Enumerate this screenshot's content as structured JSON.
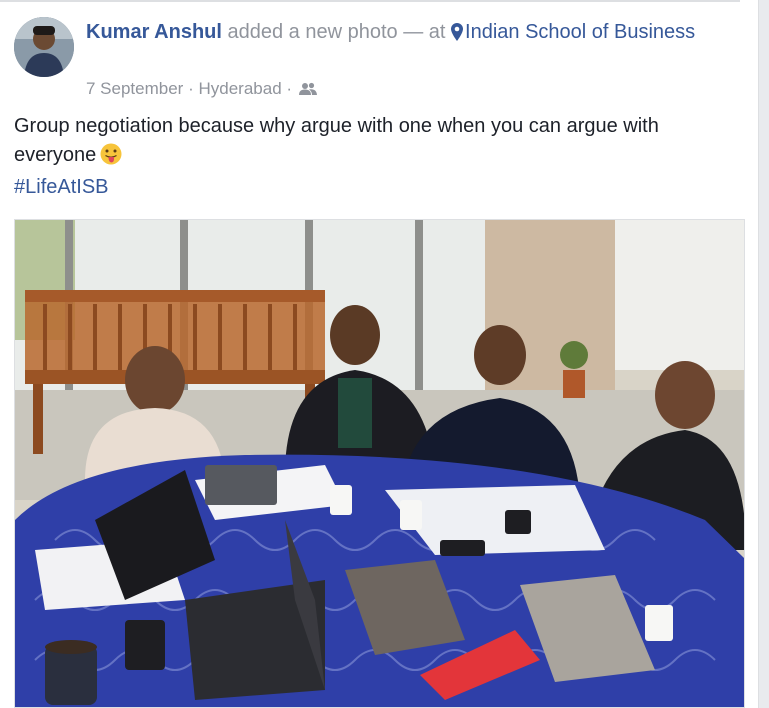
{
  "post": {
    "author_name": "Kumar Anshul",
    "action_text": "added a new photo — at",
    "place_name": "Indian School of Business",
    "date": "7 September",
    "separator": "·",
    "location": "Hyderabad",
    "audience_icon": "friends-icon",
    "message_text": "Group negotiation because why argue with one when you can argue with everyone",
    "message_emoji": "tongue-out-emoji",
    "hashtag": "#LifeAtISB"
  },
  "colors": {
    "link": "#365899",
    "meta": "#90949c",
    "text": "#1d2129",
    "tablecloth": "#2f3fa8"
  }
}
